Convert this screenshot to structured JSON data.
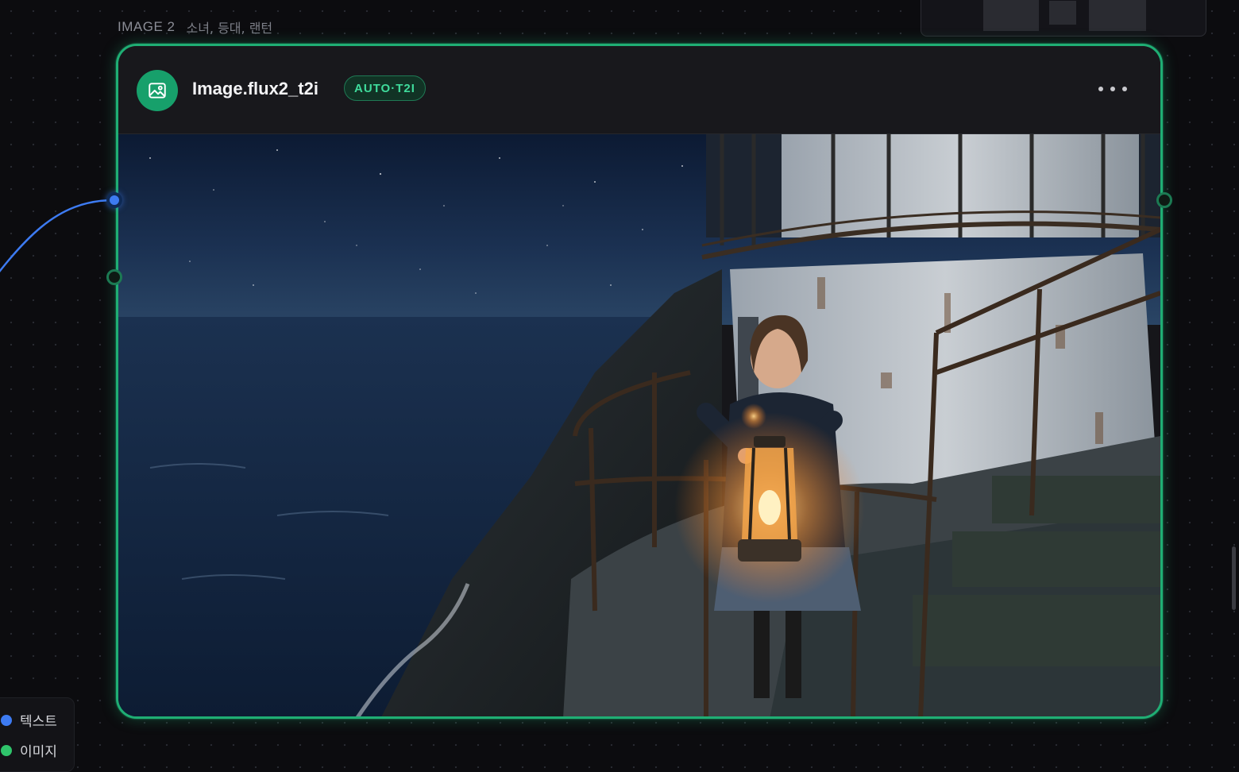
{
  "node": {
    "label": "IMAGE 2",
    "tags": "소녀, 등대, 랜턴",
    "title": "Image.flux2_t2i",
    "badge": "AUTO·T2I",
    "icon": "image-icon",
    "menu_icon": "more-horizontal-icon",
    "accent_color": "#1fae74"
  },
  "legend": {
    "items": [
      {
        "label": "텍스트",
        "color": "#3d7bf2"
      },
      {
        "label": "이미지",
        "color": "#2fc46b"
      }
    ]
  },
  "colors": {
    "canvas_bg": "#0c0c0f",
    "text_port": "#3d7bf2",
    "image_port": "#1c7a53"
  }
}
